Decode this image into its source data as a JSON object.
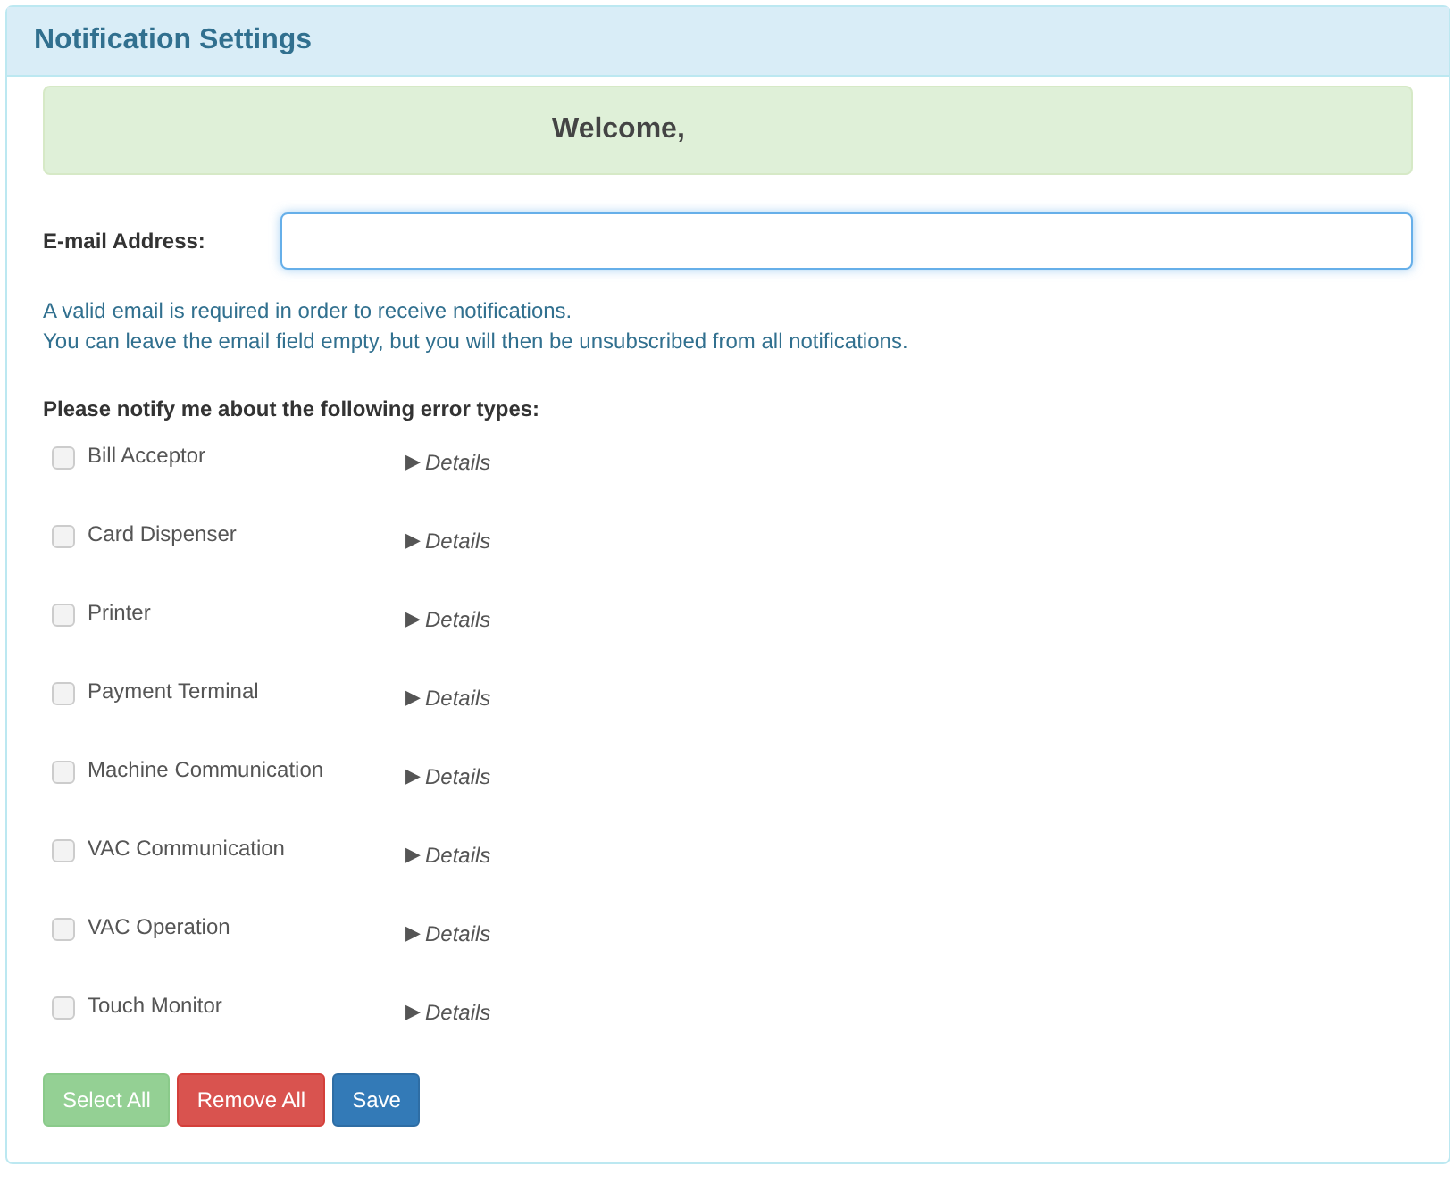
{
  "panel": {
    "title": "Notification Settings"
  },
  "welcome": "Welcome,",
  "email": {
    "label": "E-mail Address:"
  },
  "help": [
    "A valid email is required in order to receive notifications.",
    "You can leave the email field empty, but you will then be unsubscribed from all notifications."
  ],
  "error_types": {
    "heading": "Please notify me about the following error types:",
    "items": [
      {
        "label": "Bill Acceptor",
        "checked": false,
        "disabled": true,
        "toggle": "▶",
        "details": "Details"
      },
      {
        "label": "Card Dispenser",
        "checked": false,
        "disabled": true,
        "toggle": "▶",
        "details": "Details"
      },
      {
        "label": "Printer",
        "checked": false,
        "disabled": true,
        "toggle": "▶",
        "details": "Details"
      },
      {
        "label": "Payment Terminal",
        "checked": false,
        "disabled": true,
        "toggle": "▶",
        "details": "Details"
      },
      {
        "label": "Machine Communication",
        "checked": false,
        "disabled": true,
        "toggle": "▶",
        "details": "Details"
      },
      {
        "label": "VAC Communication",
        "checked": false,
        "disabled": true,
        "toggle": "▶",
        "details": "Details"
      },
      {
        "label": "VAC Operation",
        "checked": false,
        "disabled": true,
        "toggle": "▶",
        "details": "Details"
      },
      {
        "label": "Touch Monitor",
        "checked": false,
        "disabled": true,
        "toggle": "▶",
        "details": "Details"
      }
    ]
  },
  "buttons": [
    {
      "label": "Select All",
      "kind": "success",
      "disabled": true
    },
    {
      "label": "Remove All",
      "kind": "danger",
      "disabled": false
    },
    {
      "label": "Save",
      "kind": "primary",
      "disabled": false
    }
  ]
}
